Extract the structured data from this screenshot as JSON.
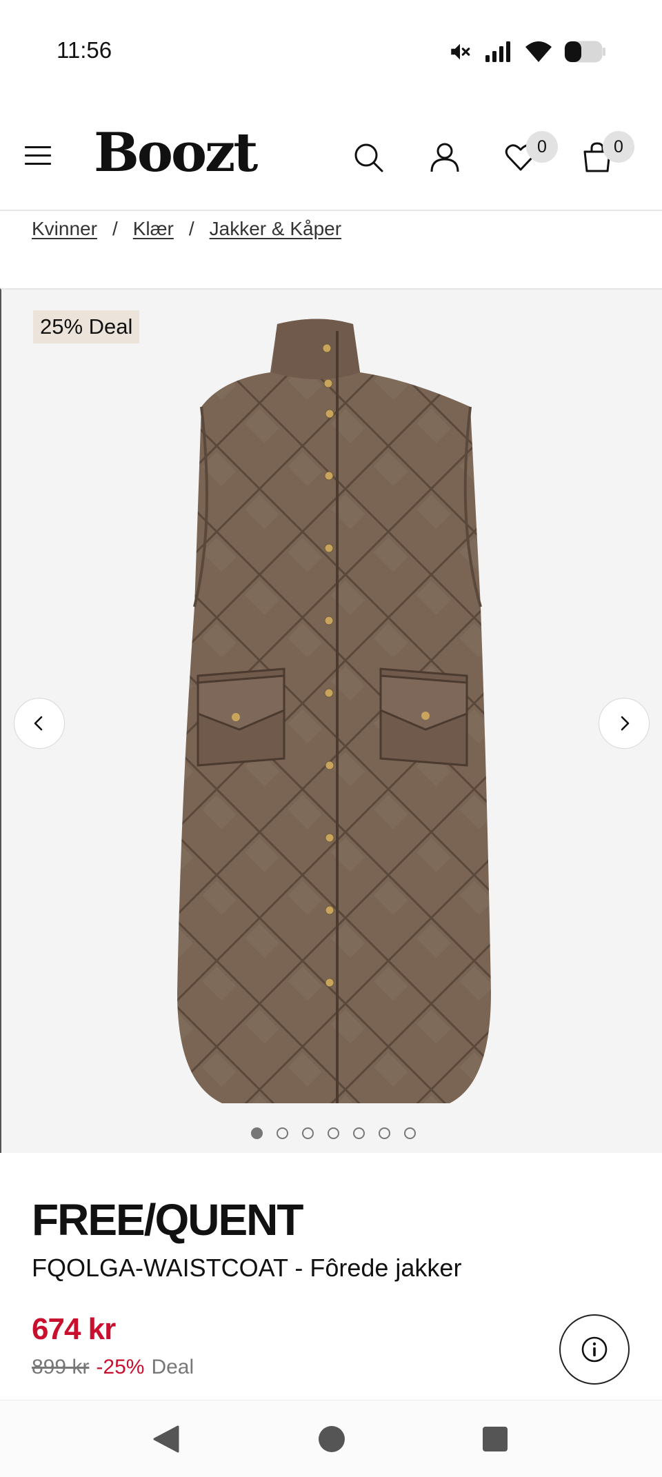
{
  "status_bar": {
    "time": "11:56",
    "icons": [
      "mute-icon",
      "signal-icon",
      "wifi-icon",
      "battery-icon"
    ]
  },
  "header": {
    "logo": "Boozt",
    "wishlist_count": "0",
    "cart_count": "0",
    "icons": [
      "menu-icon",
      "search-icon",
      "user-icon",
      "heart-icon",
      "bag-icon"
    ]
  },
  "breadcrumb": [
    "Kvinner",
    "Klær",
    "Jakker & Kåper"
  ],
  "gallery": {
    "badge": "25% Deal",
    "image_count": 7,
    "active_index": 0
  },
  "product": {
    "brand": "FREE/QUENT",
    "name": "FQOLGA-WAISTCOAT - Fôrede jakker",
    "price": "674 kr",
    "old_price": "899 kr",
    "discount": "-25%",
    "deal_label": "Deal"
  },
  "colors": {
    "sale_red": "#c8102e",
    "badge_bg": "#ece4db",
    "gallery_bg": "#f4f4f4",
    "vest_brown": "#7a6555"
  }
}
